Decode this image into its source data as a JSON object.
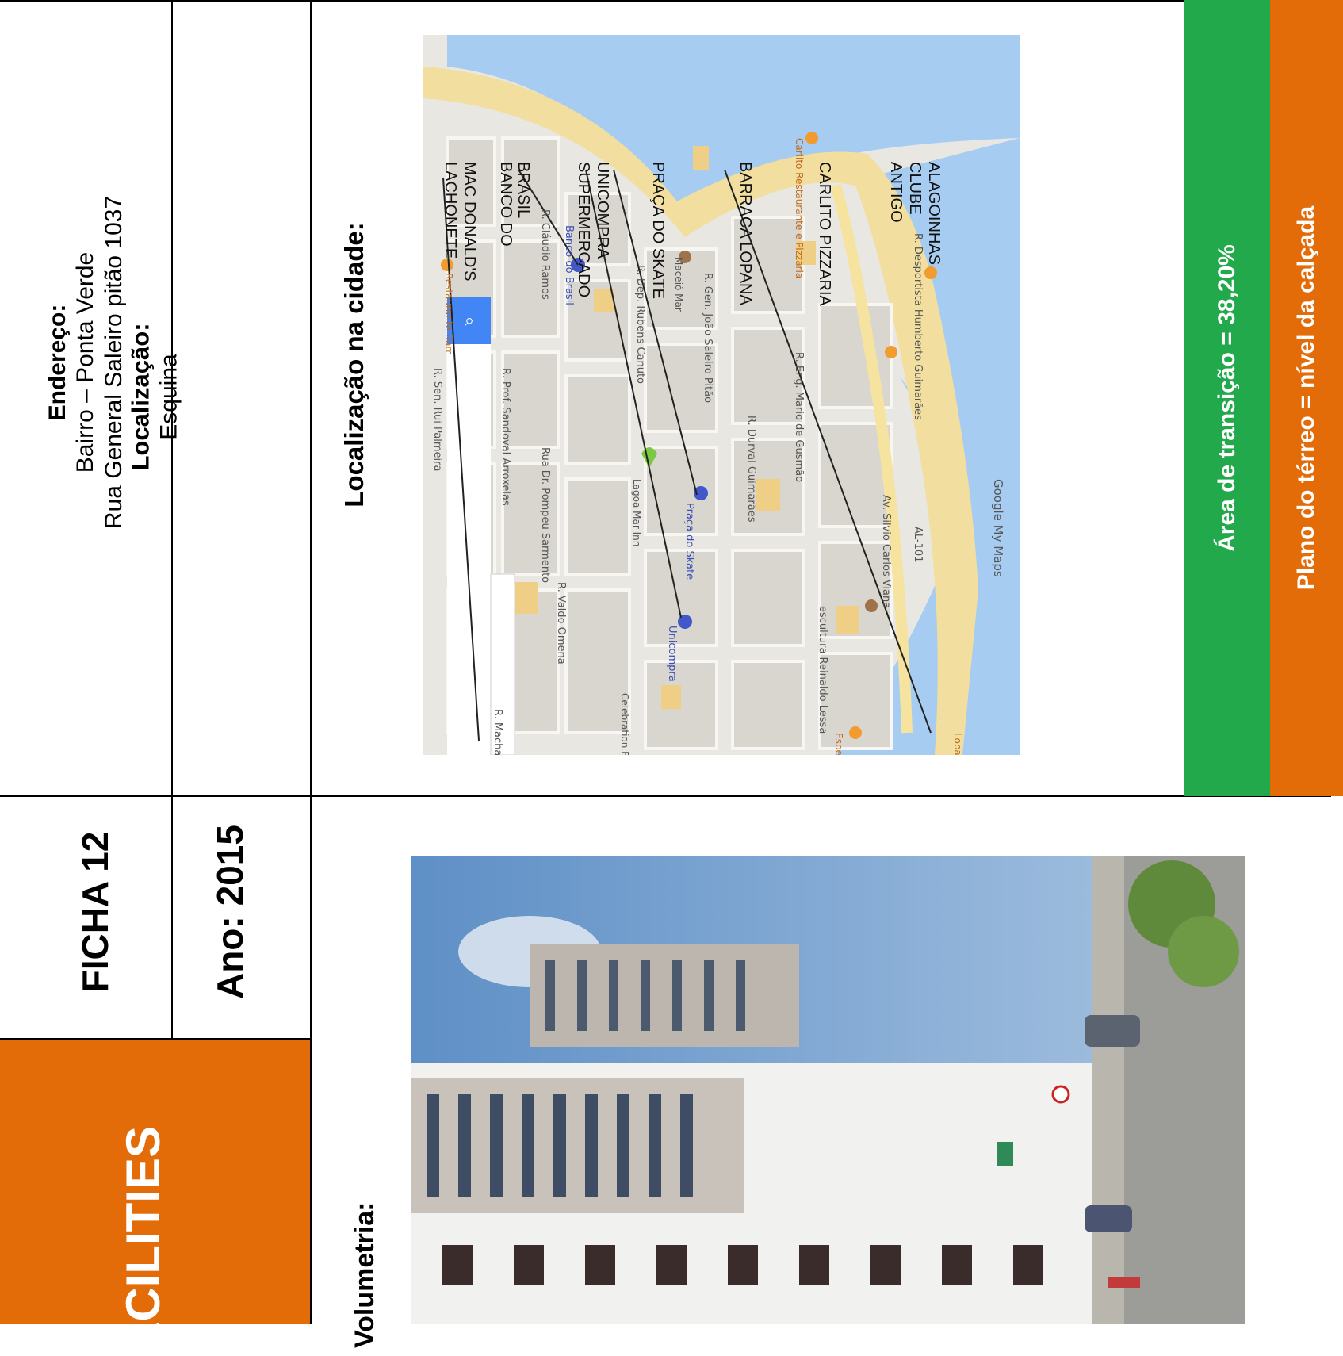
{
  "header": {
    "facilities": "ACILITIES",
    "ficha": "FICHA 12",
    "ano": "Ano: 2015"
  },
  "endereco": {
    "label": "Endereço:",
    "line1": "Bairro – Ponta Verde",
    "line2": "Rua General Saleiro pitão 1037"
  },
  "localizacao": {
    "label": "Localização:",
    "value": "Esquina"
  },
  "cidade": {
    "label": "Localização na cidade:"
  },
  "volumetria": {
    "label": "Volumetria:"
  },
  "bars": {
    "transicao": "Área de transição = 38,20%",
    "terreo": "Plano do térreo = nível da calçada"
  },
  "map": {
    "annotations": [
      "LACHONETE MAC DONALD'S",
      "BANCO DO BRASIL",
      "SUPERMERCADO UNICOMPRA",
      "PRAÇA DO SKATE",
      "BARRACA LOPANA",
      "CARLITO PIZZARIA",
      "ANTIGO CLUBE ALAGOINHAS"
    ],
    "streets": [
      "R. Cláudio Ramos",
      "Rua Dr. Pompeu Sarmento",
      "R. Valdo Omena",
      "R. Machado Lemos",
      "R. Prof. Sandoval Arroxelas",
      "R. Dep. Rubens Canuto",
      "R. Gen. João Saleiro Pitão",
      "R. Durval Guimarães",
      "R. Eng. Mario de Gusmão",
      "Av. Silvio Carlos Viana",
      "R. Desportista Humberto Guimarães",
      "R. Sen. Rui Palmeira"
    ],
    "places": [
      "Banco do Brasil",
      "Restaurante Barr",
      "Maceió Mar",
      "Lagoa Mar Inn",
      "Praça do Skate",
      "Unicompra",
      "Celebration Entretenimento",
      "Espeto Grill",
      "escultura Reinaldo Lessa",
      "Lopana",
      "Carlito Restaurante e Pizzaria",
      "AL-101"
    ],
    "brand": "Google My Maps"
  },
  "colors": {
    "orange": "#E36C09",
    "green": "#21A94B",
    "water": "#9FC7EF",
    "beach": "#F3E2A6"
  }
}
